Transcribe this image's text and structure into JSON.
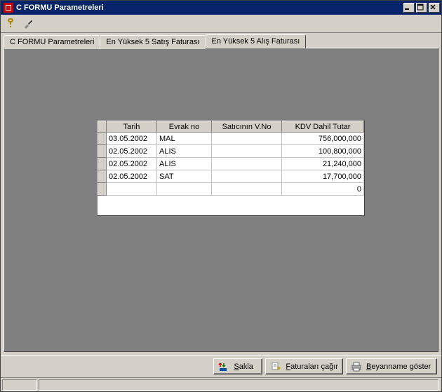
{
  "window": {
    "title": "C FORMU Parametreleri"
  },
  "tabs": [
    {
      "label": "C FORMU Parametreleri",
      "active": false
    },
    {
      "label": "En Yüksek 5 Satış Faturası",
      "active": false
    },
    {
      "label": "En Yüksek 5 Alış Faturası",
      "active": true
    }
  ],
  "grid": {
    "headers": {
      "tarih": "Tarih",
      "evrak": "Evrak no",
      "vno": "Satıcının V.No",
      "tutar": "KDV Dahil Tutar"
    },
    "rows": [
      {
        "tarih": "03.05.2002",
        "evrak": "MAL",
        "vno": "",
        "tutar": "756,000,000"
      },
      {
        "tarih": "02.05.2002",
        "evrak": "ALIS",
        "vno": "",
        "tutar": "100,800,000"
      },
      {
        "tarih": "02.05.2002",
        "evrak": "ALIS",
        "vno": "",
        "tutar": "21,240,000"
      },
      {
        "tarih": "02.05.2002",
        "evrak": "SAT",
        "vno": "",
        "tutar": "17,700,000"
      },
      {
        "tarih": "",
        "evrak": "",
        "vno": "",
        "tutar": "0"
      }
    ]
  },
  "buttons": {
    "save": "Sakla",
    "call": "Faturaları çağır",
    "show": "Beyanname göster"
  },
  "colors": {
    "titlebar": "#08246b",
    "face": "#d4d0c8",
    "panel": "#808080"
  }
}
